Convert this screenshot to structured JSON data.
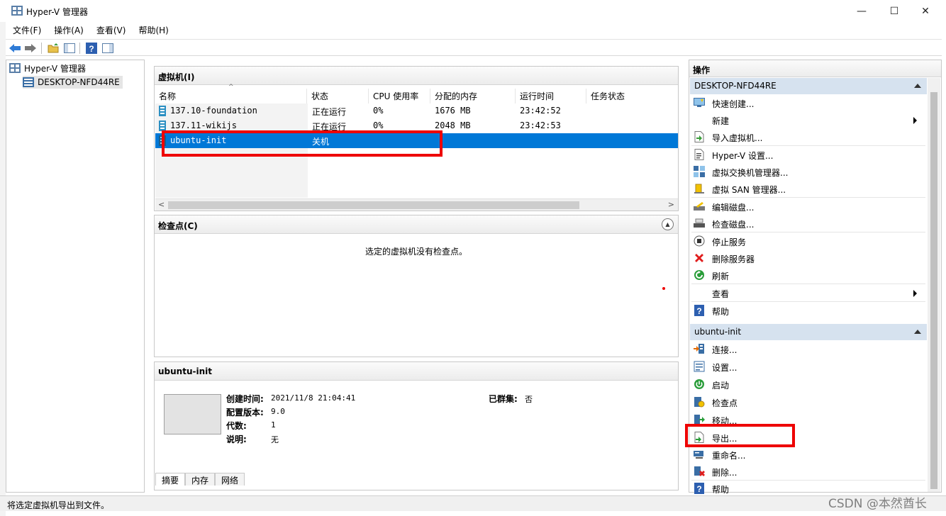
{
  "window": {
    "title": "Hyper-V 管理器",
    "min": "—",
    "max": "☐",
    "close": "✕"
  },
  "menu": [
    "文件(F)",
    "操作(A)",
    "查看(V)",
    "帮助(H)"
  ],
  "tree": {
    "root": "Hyper-V 管理器",
    "host": "DESKTOP-NFD44RE"
  },
  "vm_panel": {
    "title": "虚拟机(I)",
    "columns": [
      "名称",
      "状态",
      "CPU 使用率",
      "分配的内存",
      "运行时间",
      "任务状态"
    ],
    "rows": [
      {
        "name": "137.10-foundation",
        "state": "正在运行",
        "cpu": "0%",
        "memory": "1676 MB",
        "uptime": "23:42:52",
        "task": ""
      },
      {
        "name": "137.11-wikijs",
        "state": "正在运行",
        "cpu": "0%",
        "memory": "2048 MB",
        "uptime": "23:42:53",
        "task": ""
      },
      {
        "name": "ubuntu-init",
        "state": "关机",
        "cpu": "",
        "memory": "",
        "uptime": "",
        "task": ""
      }
    ]
  },
  "checkpoint_panel": {
    "title": "检查点(C)",
    "empty_text": "选定的虚拟机没有检查点。"
  },
  "info_panel": {
    "title": "ubuntu-init",
    "created_label": "创建时间:",
    "created_value": "2021/11/8 21:04:41",
    "version_label": "配置版本:",
    "version_value": "9.0",
    "generation_label": "代数:",
    "generation_value": "1",
    "notes_label": "说明:",
    "notes_value": "无",
    "clustered_label": "已群集:",
    "clustered_value": "否",
    "tabs": [
      "摘要",
      "内存",
      "网络"
    ]
  },
  "actions": {
    "title": "操作",
    "host_section": "DESKTOP-NFD44RE",
    "host_items": [
      "快速创建...",
      "新建",
      "导入虚拟机...",
      "Hyper-V 设置...",
      "虚拟交换机管理器...",
      "虚拟 SAN 管理器...",
      "编辑磁盘...",
      "检查磁盘...",
      "停止服务",
      "删除服务器",
      "刷新",
      "查看",
      "帮助"
    ],
    "vm_section": "ubuntu-init",
    "vm_items": [
      "连接...",
      "设置...",
      "启动",
      "检查点",
      "移动...",
      "导出...",
      "重命名...",
      "删除...",
      "帮助"
    ]
  },
  "status_text": "将选定虚拟机导出到文件。",
  "watermark": "CSDN @本然酋长",
  "colors": {
    "selection": "#0078d7",
    "section_header": "#d6e2ef",
    "highlight": "#ee0000"
  }
}
